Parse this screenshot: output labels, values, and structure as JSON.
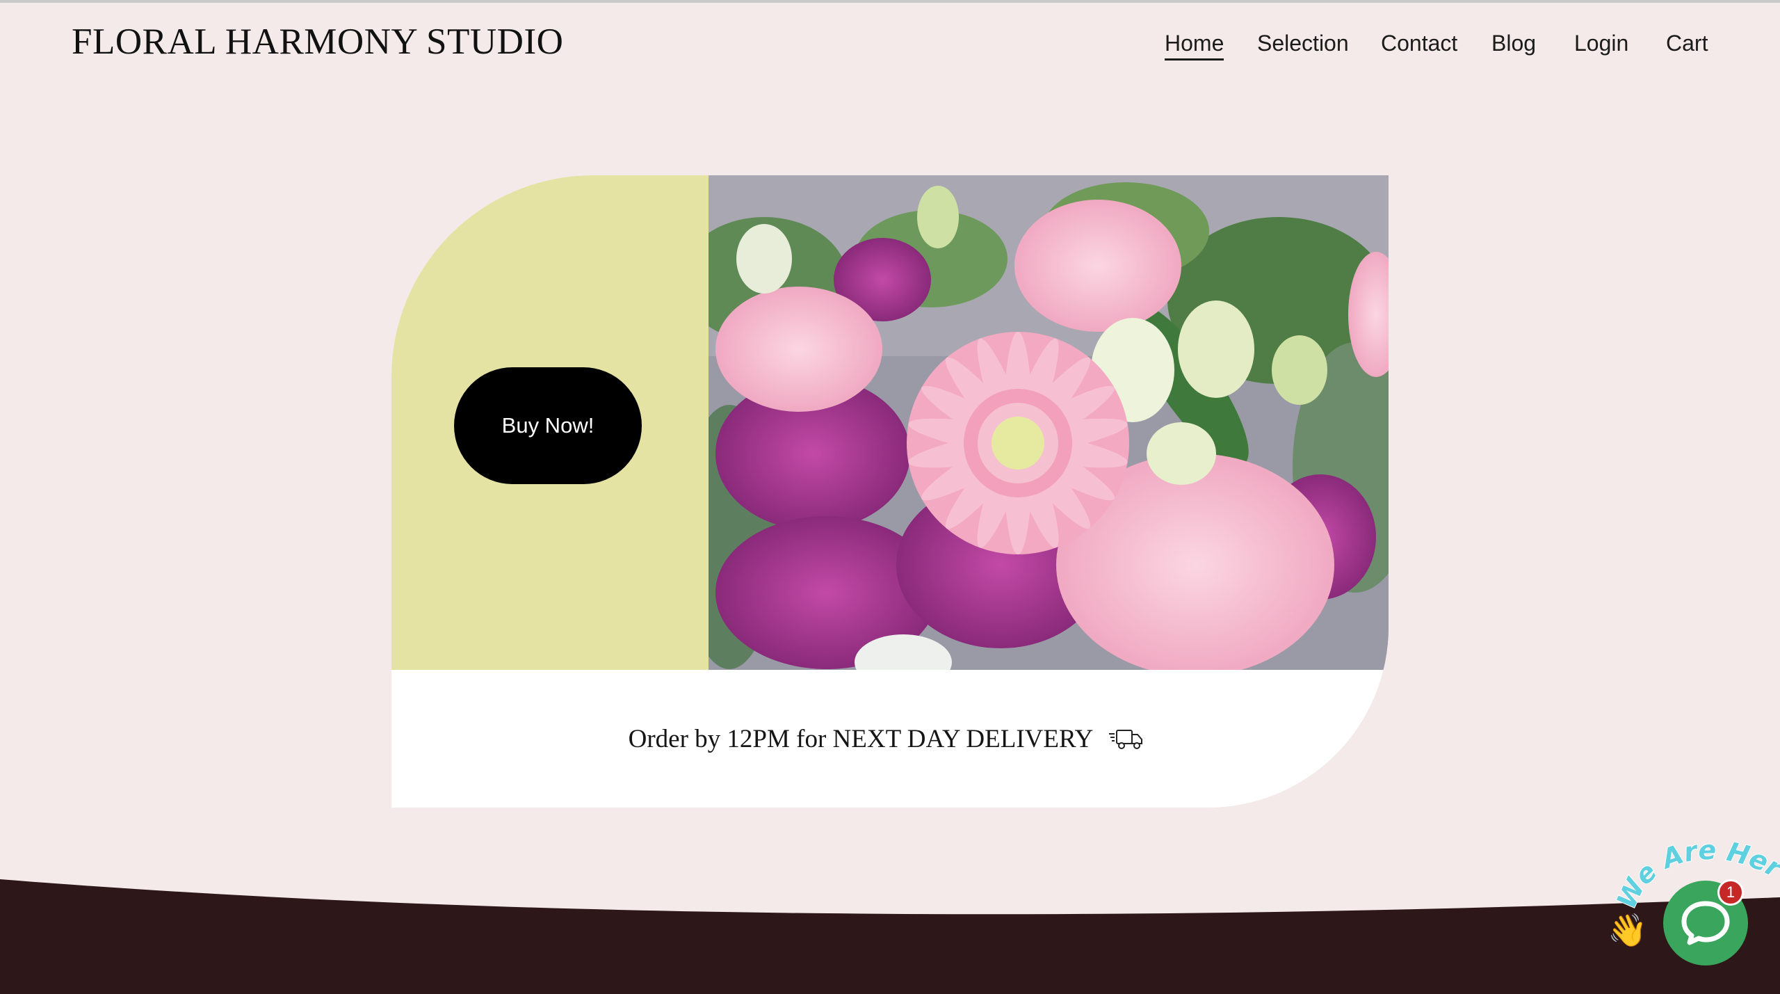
{
  "site": {
    "title": "FLORAL HARMONY STUDIO"
  },
  "nav": {
    "items": [
      {
        "label": "Home",
        "active": true
      },
      {
        "label": "Selection",
        "active": false
      },
      {
        "label": "Contact",
        "active": false
      },
      {
        "label": "Blog",
        "active": false
      },
      {
        "label": "Login",
        "active": false
      },
      {
        "label": "Cart",
        "active": false
      }
    ]
  },
  "hero": {
    "buy_button_label": "Buy Now!",
    "photo": "pink gerbera, carnations and purple statice bouquet",
    "delivery_text": "Order by 12PM for NEXT DAY DELIVERY",
    "delivery_icon": "truck-icon"
  },
  "chat_widget": {
    "banner_text": "We Are Here!",
    "unread_count": "1",
    "hand_icon": "waving-hand-icon",
    "chat_icon": "chat-bubble-icon"
  },
  "colors": {
    "page_background": "#f4eaea",
    "hero_green": "#e4e3a4",
    "button_black": "#000000",
    "footer_maroon": "#2e1718",
    "chat_green": "#3aa55c",
    "badge_red": "#c62828"
  }
}
